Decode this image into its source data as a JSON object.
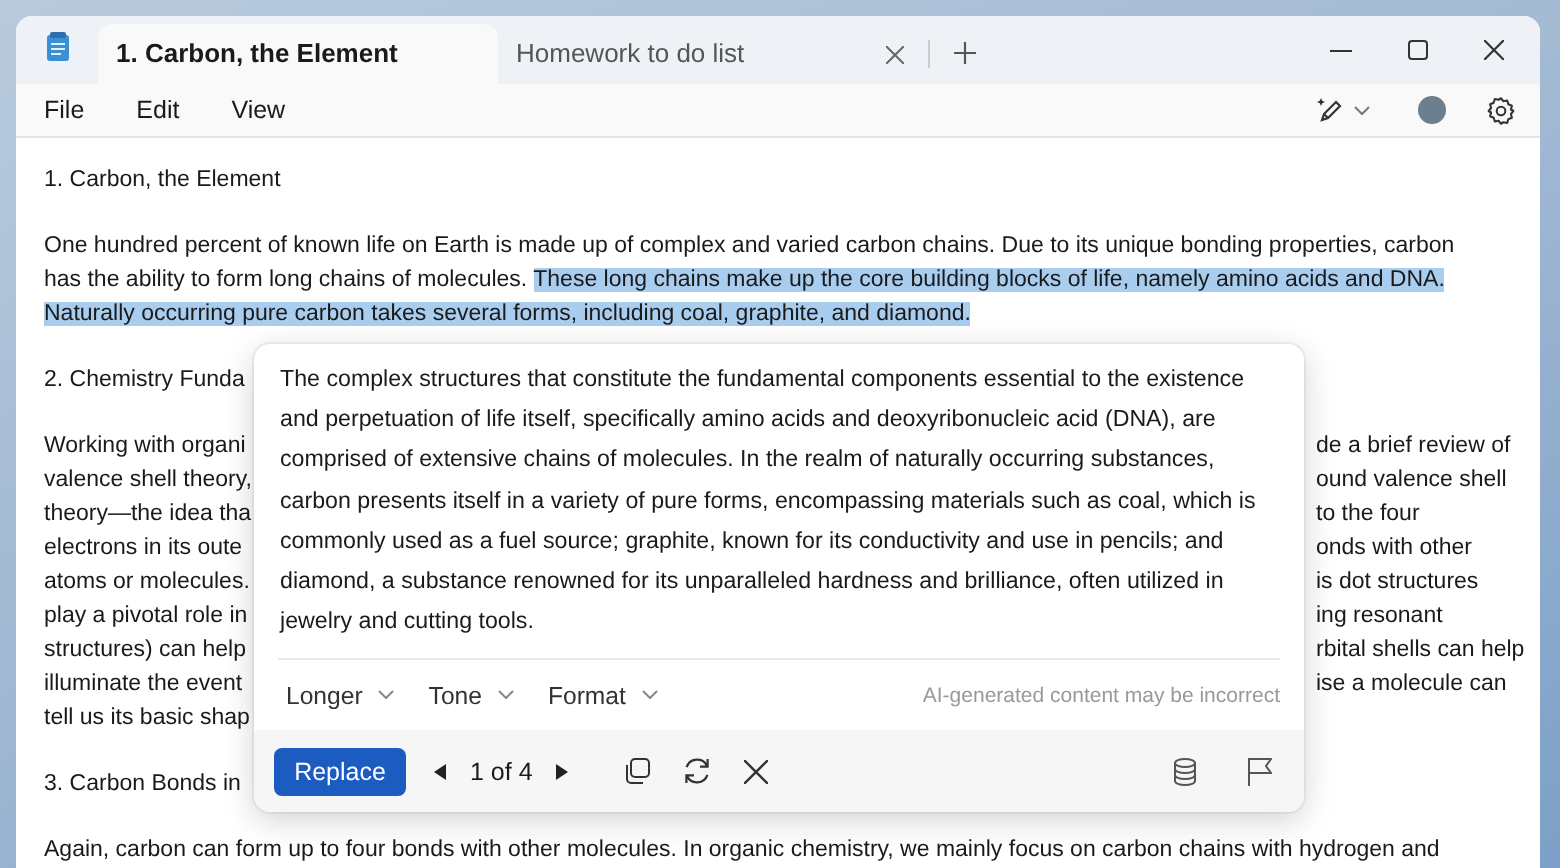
{
  "window": {
    "tabs": [
      {
        "label": "1. Carbon, the Element",
        "selected": true
      },
      {
        "label": "Homework to do list",
        "selected": false
      }
    ]
  },
  "menu": [
    "File",
    "Edit",
    "View"
  ],
  "document": {
    "paragraphs": [
      {
        "lines": [
          {
            "kind": "full",
            "segments": [
              {
                "text": "1. Carbon, the Element",
                "highlighted": false
              }
            ]
          }
        ]
      },
      {
        "lines": [
          {
            "kind": "full",
            "segments": [
              {
                "text": "One hundred percent of known life on Earth is made up of complex and varied carbon chains. Due to its unique bonding properties, carbon",
                "highlighted": false
              }
            ]
          },
          {
            "kind": "full",
            "segments": [
              {
                "text": "has the ability to form long chains of molecules. ",
                "highlighted": false
              },
              {
                "text": "These long chains make up the core building blocks of life, namely amino acids and DNA.",
                "highlighted": true
              }
            ]
          },
          {
            "kind": "full",
            "segments": [
              {
                "text": "Naturally occurring pure carbon takes several forms, including coal, graphite, and diamond.",
                "highlighted": true
              }
            ]
          }
        ]
      },
      {
        "lines": [
          {
            "kind": "split",
            "left": "2. Chemistry Funda"
          }
        ]
      },
      {
        "lines": [
          {
            "kind": "split",
            "left": "Working with organi",
            "right": "de a brief review of"
          },
          {
            "kind": "split",
            "left": "valence shell theory,",
            "right": "ound valence shell"
          },
          {
            "kind": "split",
            "left": "theory—the idea tha",
            "right": "to the four"
          },
          {
            "kind": "split",
            "left": "electrons in its oute",
            "right": "onds with other"
          },
          {
            "kind": "split",
            "left": "atoms or molecules.",
            "right": "is dot structures"
          },
          {
            "kind": "split",
            "left": "play a pivotal role in",
            "right": "ing resonant"
          },
          {
            "kind": "split",
            "left": "structures) can help",
            "right": "rbital shells can help"
          },
          {
            "kind": "split",
            "left": "illuminate the event",
            "right": "ise a molecule can"
          },
          {
            "kind": "split",
            "left": "tell us its basic shap"
          }
        ]
      },
      {
        "lines": [
          {
            "kind": "split",
            "left": "3. Carbon Bonds in"
          }
        ]
      },
      {
        "lines": [
          {
            "kind": "full",
            "segments": [
              {
                "text": "Again, carbon can form up to four bonds with other molecules. In organic chemistry, we mainly focus on carbon chains with hydrogen and",
                "highlighted": false
              }
            ]
          }
        ]
      }
    ]
  },
  "rewrite_popup": {
    "text_lines": [
      "The complex structures that constitute the fundamental components essential to the existence",
      "and perpetuation of life itself, specifically amino acids and deoxyribonucleic acid (DNA), are",
      "comprised of extensive chains of molecules. In the realm of naturally occurring substances,",
      "carbon presents itself in a variety of pure forms, encompassing materials such as coal, which is",
      "commonly used as a fuel source; graphite, known for its conductivity and use in pencils; and",
      "diamond, a substance renowned for its unparalleled hardness and brilliance, often utilized in",
      "jewelry and cutting tools."
    ],
    "options": [
      "Longer",
      "Tone",
      "Format"
    ],
    "disclaimer": "AI-generated content may be incorrect",
    "primary_button": "Replace",
    "pager": "1 of 4"
  }
}
